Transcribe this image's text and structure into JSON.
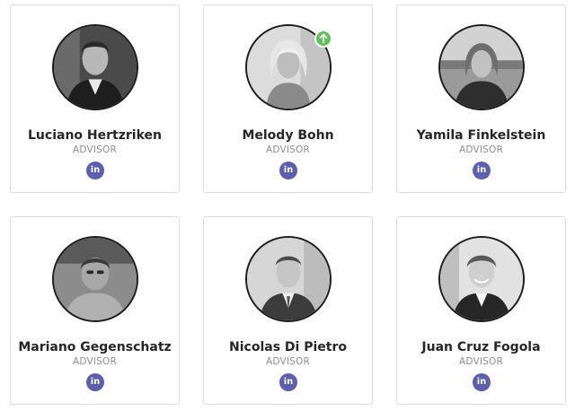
{
  "colors": {
    "linkedin": "#5b5fae",
    "badge": "#5cc25a",
    "name": "#262626",
    "role": "#8e8e8e",
    "border": "#dcdcdc"
  },
  "linkedin_icon_glyph": "in",
  "cards": [
    {
      "name": "Luciano Hertzriken",
      "role": "ADVISOR"
    },
    {
      "name": "Melody Bohn",
      "role": "ADVISOR",
      "badge_icon": "arrow-up-icon"
    },
    {
      "name": "Yamila Finkelstein",
      "role": "ADVISOR"
    },
    {
      "name": "Mariano Gegenschatz",
      "role": "ADVISOR"
    },
    {
      "name": "Nicolas Di Pietro",
      "role": "ADVISOR"
    },
    {
      "name": "Juan Cruz Fogola",
      "role": "ADVISOR"
    }
  ]
}
